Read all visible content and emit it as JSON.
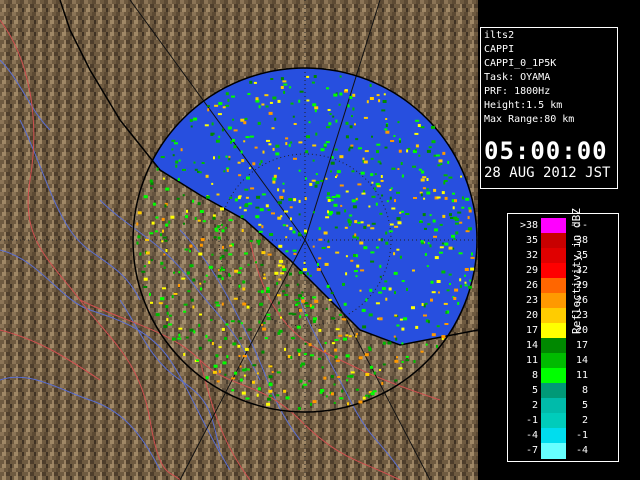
{
  "info": {
    "lines": [
      "ilts2",
      "CAPPI",
      "CAPPI_0_1P5K",
      "Task: OYAMA",
      "PRF: 1800Hz",
      "Height:1.5 km",
      "Max Range:80 km"
    ],
    "time": "05:00:00",
    "date": "28 AUG 2012 JST"
  },
  "legend": {
    "title": "Reflectivity in dBZ",
    "rows": [
      {
        "left": ">38",
        "right": "---",
        "color": "#ff00ff"
      },
      {
        "left": "35",
        "right": "38",
        "color": "#c80000"
      },
      {
        "left": "32",
        "right": "35",
        "color": "#e00000"
      },
      {
        "left": "29",
        "right": "32",
        "color": "#ff0000"
      },
      {
        "left": "26",
        "right": "29",
        "color": "#ff6600"
      },
      {
        "left": "23",
        "right": "26",
        "color": "#ff9900"
      },
      {
        "left": "20",
        "right": "23",
        "color": "#ffcc00"
      },
      {
        "left": "17",
        "right": "20",
        "color": "#ffff00"
      },
      {
        "left": "14",
        "right": "17",
        "color": "#008800"
      },
      {
        "left": "11",
        "right": "14",
        "color": "#00bb00"
      },
      {
        "left": "8",
        "right": "11",
        "color": "#00ff00"
      },
      {
        "left": "5",
        "right": "8",
        "color": "#009977"
      },
      {
        "left": "2",
        "right": "5",
        "color": "#00bbaa"
      },
      {
        "left": "-1",
        "right": "2",
        "color": "#00ccbb"
      },
      {
        "left": "-4",
        "right": "-1",
        "color": "#00ddee"
      },
      {
        "left": "-7",
        "right": "-4",
        "color": "#66ffff"
      }
    ]
  },
  "map_colors": {
    "sea": "#1a44dd",
    "land": "#6e5a40",
    "rivers": "#5b6fd0",
    "borders": "#d05050",
    "grid": "#222222"
  }
}
